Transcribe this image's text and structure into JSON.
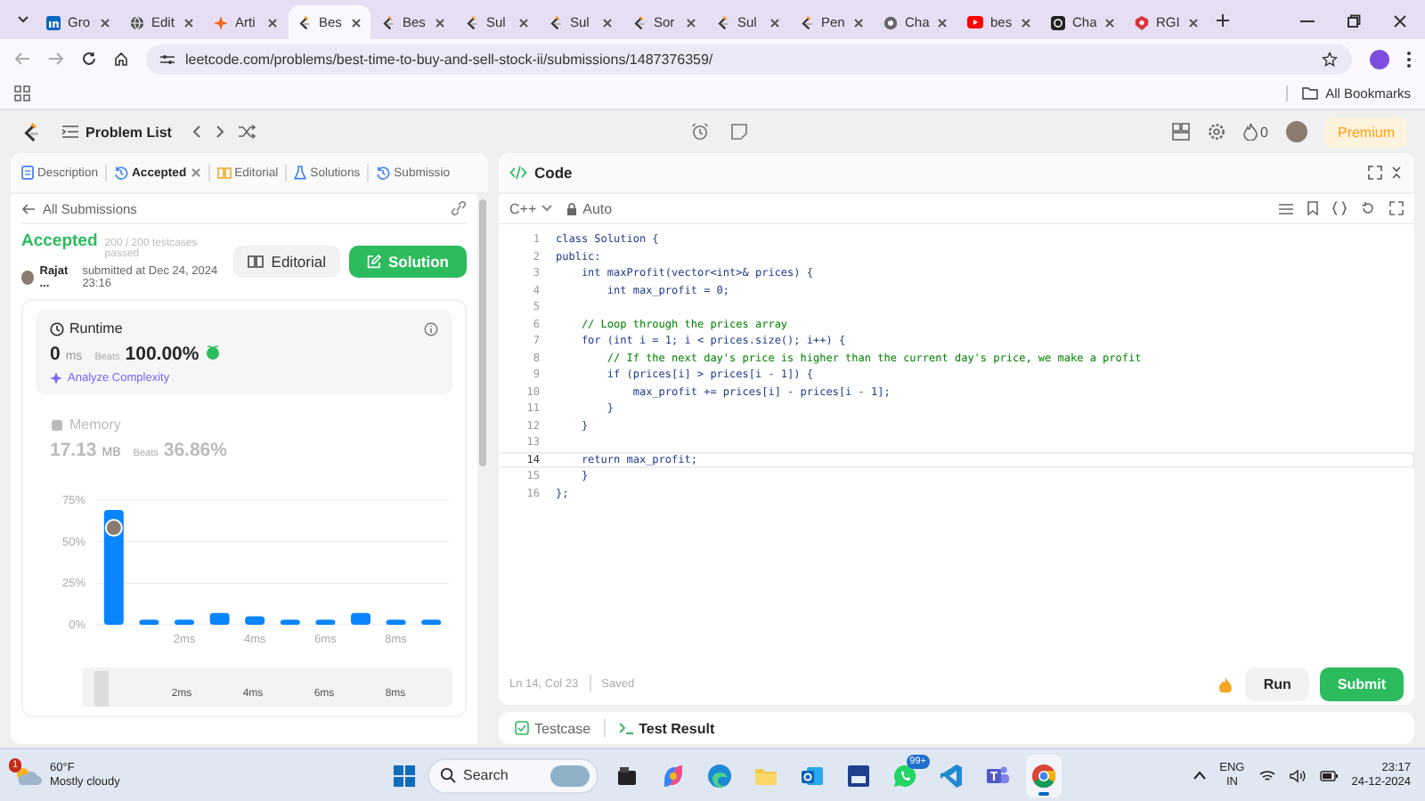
{
  "browser": {
    "tabs": [
      {
        "label": "Gro",
        "kind": "linkedin",
        "selected": false
      },
      {
        "label": "Edit",
        "kind": "globe",
        "selected": false
      },
      {
        "label": "Arti",
        "kind": "sparkle",
        "selected": false
      },
      {
        "label": "Bes",
        "kind": "leetcode",
        "selected": true
      },
      {
        "label": "Bes",
        "kind": "leetcode",
        "selected": false
      },
      {
        "label": "Sul",
        "kind": "leetcode",
        "selected": false
      },
      {
        "label": "Sul",
        "kind": "leetcode",
        "selected": false
      },
      {
        "label": "Sor",
        "kind": "leetcode",
        "selected": false
      },
      {
        "label": "Sul",
        "kind": "leetcode",
        "selected": false
      },
      {
        "label": "Pen",
        "kind": "leetcode",
        "selected": false
      },
      {
        "label": "Cha",
        "kind": "chat-light",
        "selected": false
      },
      {
        "label": "bes",
        "kind": "youtube",
        "selected": false
      },
      {
        "label": "Cha",
        "kind": "chat-dark",
        "selected": false
      },
      {
        "label": "RGI",
        "kind": "rg",
        "selected": false
      }
    ],
    "url": "leetcode.com/problems/best-time-to-buy-and-sell-stock-ii/submissions/1487376359/",
    "bookmarks_label": "All Bookmarks"
  },
  "nav": {
    "title": "Problem List",
    "streak": "0",
    "premium": "Premium"
  },
  "left": {
    "tabs": [
      {
        "label": "Description",
        "kind": "doc",
        "selected": false,
        "closable": false
      },
      {
        "label": "Accepted",
        "kind": "history",
        "selected": true,
        "closable": true
      },
      {
        "label": "Editorial",
        "kind": "book",
        "selected": false,
        "closable": false
      },
      {
        "label": "Solutions",
        "kind": "flask",
        "selected": false,
        "closable": false
      },
      {
        "label": "Submissio",
        "kind": "history",
        "selected": false,
        "closable": false
      }
    ],
    "back_label": "All Submissions",
    "status": "Accepted",
    "testcases": "200 / 200 testcases passed",
    "author": "Rajat ...",
    "submitted": "submitted at Dec 24, 2024 23:16",
    "editorial_button": "Editorial",
    "solution_button": "Solution",
    "metrics": [
      {
        "label": "Runtime",
        "value": "0",
        "unit": "ms",
        "beats_label": "Beats",
        "beats": "100.00%",
        "selected": true,
        "award": true,
        "link": "Analyze Complexity"
      },
      {
        "label": "Memory",
        "value": "17.13",
        "unit": "MB",
        "beats_label": "Beats",
        "beats": "36.86%",
        "selected": false,
        "award": false
      }
    ],
    "chart_data": {
      "type": "bar",
      "x": [
        0,
        1,
        2,
        3,
        4,
        5,
        6,
        7,
        8,
        9
      ],
      "values": [
        68,
        2,
        2,
        6,
        4,
        2,
        2,
        6,
        2,
        2
      ],
      "xlim": [
        -0.5,
        9.5
      ],
      "ylim": [
        0,
        75
      ],
      "grid": true,
      "yticks": [
        {
          "value": 0,
          "label": "0%"
        },
        {
          "value": 25,
          "label": "25%"
        },
        {
          "value": 50,
          "label": "50%"
        },
        {
          "value": 75,
          "label": "75%"
        }
      ],
      "xticks": [
        {
          "value": 2,
          "label": "2ms"
        },
        {
          "value": 4,
          "label": "4ms"
        },
        {
          "value": 6,
          "label": "6ms"
        },
        {
          "value": 8,
          "label": "8ms"
        }
      ]
    },
    "brush_labels": [
      "2ms",
      "4ms",
      "6ms",
      "8ms"
    ]
  },
  "editor": {
    "title": "Code",
    "language": "C++",
    "mode": "Auto",
    "lines": [
      {
        "n": "1",
        "current": false,
        "kind": "code",
        "t": "class Solution {"
      },
      {
        "n": "2",
        "current": false,
        "kind": "code",
        "t": "public:"
      },
      {
        "n": "3",
        "current": false,
        "kind": "code",
        "t": "    int maxProfit(vector<int>& prices) {"
      },
      {
        "n": "4",
        "current": false,
        "kind": "code",
        "t": "        int max_profit = 0;"
      },
      {
        "n": "5",
        "current": false,
        "kind": "blank"
      },
      {
        "n": "6",
        "current": false,
        "kind": "comment",
        "t": "    // Loop through the prices array"
      },
      {
        "n": "7",
        "current": false,
        "kind": "code",
        "t": "    for (int i = 1; i < prices.size(); i++) {"
      },
      {
        "n": "8",
        "current": false,
        "kind": "comment",
        "t": "        // If the next day's price is higher than the current day's price, we make a profit"
      },
      {
        "n": "9",
        "current": false,
        "kind": "code",
        "t": "        if (prices[i] > prices[i - 1]) {"
      },
      {
        "n": "10",
        "current": false,
        "kind": "code",
        "t": "            max_profit += prices[i] - prices[i - 1];"
      },
      {
        "n": "11",
        "current": false,
        "kind": "code",
        "t": "        }"
      },
      {
        "n": "12",
        "current": false,
        "kind": "code",
        "t": "    }"
      },
      {
        "n": "13",
        "current": false,
        "kind": "blank"
      },
      {
        "n": "14",
        "current": true,
        "kind": "code",
        "t": "    return max_profit;"
      },
      {
        "n": "15",
        "current": false,
        "kind": "code",
        "t": "    }"
      },
      {
        "n": "16",
        "current": false,
        "kind": "code",
        "t": "};"
      }
    ],
    "cursor": "Ln 14, Col 23",
    "save_state": "Saved",
    "run": "Run",
    "submit": "Submit"
  },
  "console": {
    "tabs": [
      {
        "label": "Testcase",
        "kind": "check",
        "selected": false
      },
      {
        "label": "Test Result",
        "kind": "terminal",
        "selected": true
      }
    ]
  },
  "taskbar": {
    "weather": {
      "temp": "60°F",
      "desc": "Mostly cloudy",
      "badge": "1"
    },
    "search_placeholder": "Search",
    "apps": [
      {
        "kind": "files",
        "selected": false
      },
      {
        "kind": "copilot",
        "selected": false
      },
      {
        "kind": "edge",
        "selected": false
      },
      {
        "kind": "folder",
        "selected": false
      },
      {
        "kind": "mail",
        "selected": false
      },
      {
        "kind": "tile",
        "selected": false
      },
      {
        "kind": "chat",
        "selected": false,
        "badge": "99+"
      },
      {
        "kind": "code",
        "selected": false
      },
      {
        "kind": "teams",
        "selected": false
      },
      {
        "kind": "chrome",
        "selected": true
      }
    ],
    "language": "ENG",
    "region": "IN",
    "time": "23:17",
    "date": "24-12-2024"
  }
}
